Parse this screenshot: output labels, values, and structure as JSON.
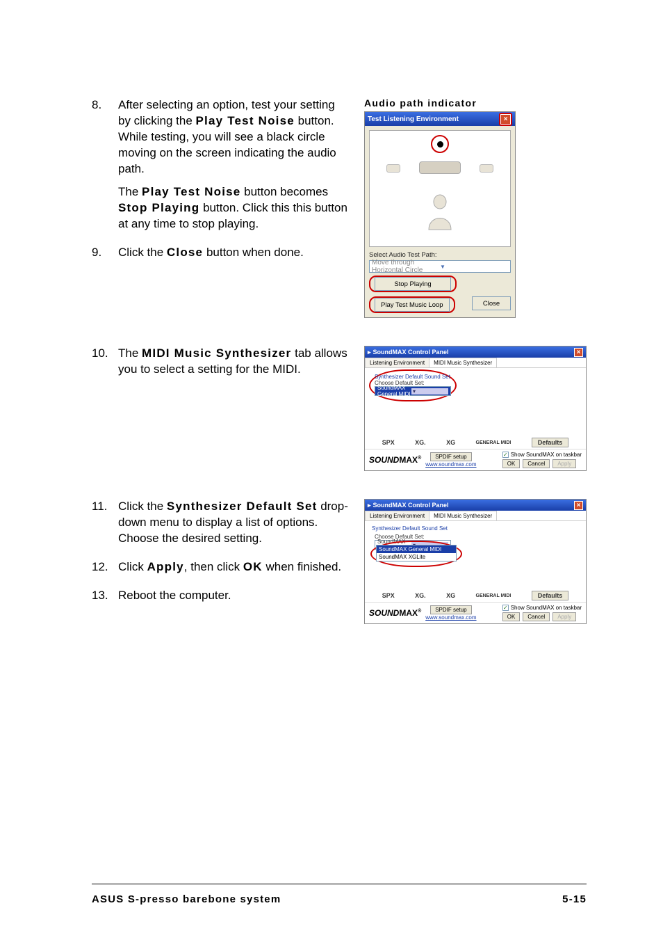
{
  "steps": {
    "s8": {
      "num": "8.",
      "p1a": "After selecting an option, test your setting by clicking the ",
      "p1b_bold": "Play Test Noise",
      "p1c": " button. While testing, you will see a black circle moving on the screen indicating the audio path.",
      "p2a": "The ",
      "p2b_bold": "Play Test Noise",
      "p2c": " button becomes ",
      "p2d_bold": "Stop Playing",
      "p2e": " button. Click this this button at any time to stop playing."
    },
    "s9": {
      "num": "9.",
      "a": "Click the ",
      "b_bold": "Close",
      "c": " button when done."
    },
    "s10": {
      "num": "10.",
      "a": "The ",
      "b_bold": "MIDI Music Synthesizer",
      "c": " tab allows you to select a setting for the MIDI."
    },
    "s11": {
      "num": "11.",
      "a": "Click the ",
      "b_bold": "Synthesizer Default Set",
      "c": " drop-down menu to display a list of options. Choose the desired setting."
    },
    "s12": {
      "num": "12.",
      "a": "Click ",
      "b_bold": "Apply",
      "c": ", then click ",
      "d_bold": "OK",
      "e": " when finished."
    },
    "s13": {
      "num": "13.",
      "a": "Reboot the computer."
    }
  },
  "fig1": {
    "caption": "Audio path indicator",
    "title": "Test Listening Environment",
    "selectLabel": "Select Audio Test Path:",
    "dropdownValue": "Move through Horizontal Circle",
    "stopBtn": "Stop Playing",
    "playBtn": "Play Test Music Loop",
    "closeBtn": "Close"
  },
  "smx": {
    "title": "SoundMAX Control Panel",
    "tab1": "Listening Environment",
    "tab2": "MIDI Music Synthesizer",
    "group": "Synthesizer Default Sound Set",
    "chooseLabel": "Choose Default Set:",
    "default": "SoundMAX General MIDI",
    "opt2": "SoundMAX General MIDI",
    "opt3": "SoundMAX XGLite",
    "logo_spx": "SPX",
    "logo_xg1": "XG.",
    "logo_xg2": "XG",
    "logo_midi": "GENERAL MIDI",
    "defaultsBtn": "Defaults",
    "brand_pre": "SOUND",
    "brand_main": "MAX",
    "brand_sup": "®",
    "spdif": "SPDIF setup",
    "url": "www.soundmax.com",
    "check": "Show SoundMAX on taskbar",
    "ok": "OK",
    "cancel": "Cancel",
    "apply": "Apply"
  },
  "footer": {
    "left": "ASUS S-presso barebone system",
    "right": "5-15"
  }
}
